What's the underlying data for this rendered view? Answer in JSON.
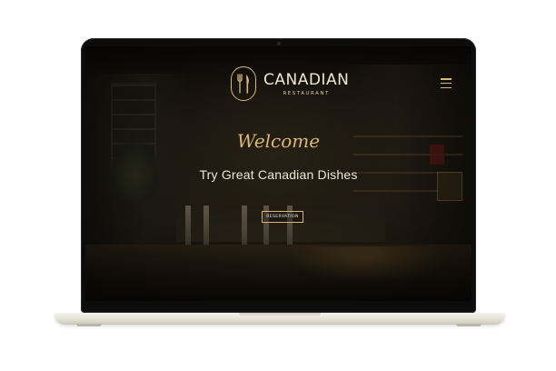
{
  "site": {
    "brand": "CANADIAN",
    "brand_subtitle": "RESTAURANT",
    "logo_icon": "fork-knife-icon",
    "menu_icon": "hamburger-menu-icon"
  },
  "hero": {
    "welcome": "Welcome",
    "tagline": "Try Great Canadian Dishes",
    "reservation_label": "RESERVATION"
  },
  "colors": {
    "accent_gold": "#d8b77a",
    "text_light": "#efe6d5",
    "background_dark": "#17130f",
    "laptop_silver": "#e4e1d6"
  }
}
